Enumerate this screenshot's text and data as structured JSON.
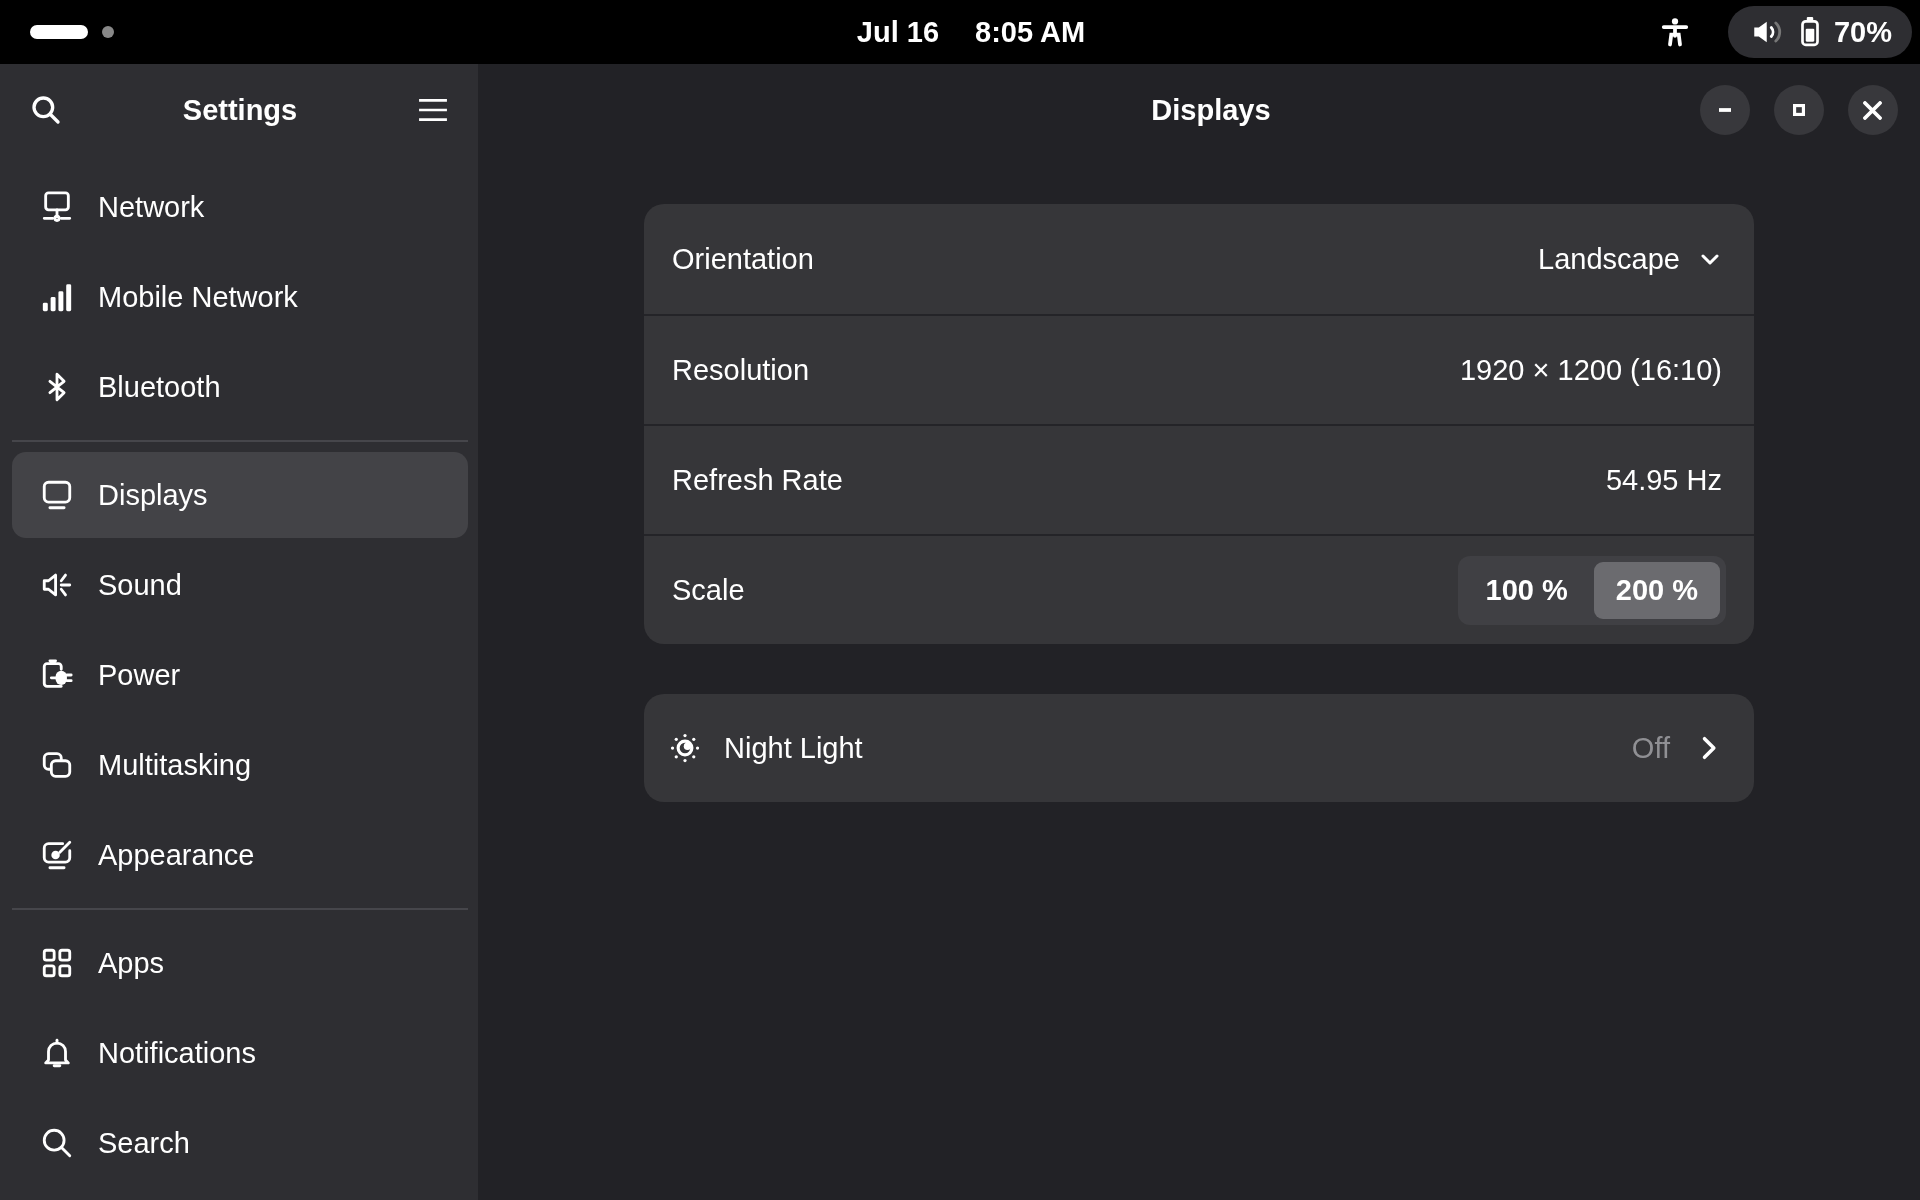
{
  "top_bar": {
    "date": "Jul 16",
    "time": "8:05 AM",
    "battery": "70%"
  },
  "sidebar": {
    "title": "Settings",
    "sections": [
      [
        {
          "label": "Network",
          "selected": false
        },
        {
          "label": "Mobile Network",
          "selected": false
        },
        {
          "label": "Bluetooth",
          "selected": false
        }
      ],
      [
        {
          "label": "Displays",
          "selected": true
        },
        {
          "label": "Sound",
          "selected": false
        },
        {
          "label": "Power",
          "selected": false
        },
        {
          "label": "Multitasking",
          "selected": false
        },
        {
          "label": "Appearance",
          "selected": false
        }
      ],
      [
        {
          "label": "Apps",
          "selected": false
        },
        {
          "label": "Notifications",
          "selected": false
        },
        {
          "label": "Search",
          "selected": false
        }
      ]
    ]
  },
  "window": {
    "title": "Displays"
  },
  "display_settings": [
    {
      "kind": "dropdown",
      "label": "Orientation",
      "value": "Landscape"
    },
    {
      "kind": "text",
      "label": "Resolution",
      "value": "1920 × 1200 (16:10)"
    },
    {
      "kind": "text",
      "label": "Refresh Rate",
      "value": "54.95 Hz"
    },
    {
      "kind": "toggle_group",
      "label": "Scale",
      "options": [
        {
          "label": "100 %",
          "selected": false
        },
        {
          "label": "200 %",
          "selected": true
        }
      ]
    }
  ],
  "night_light": {
    "label": "Night Light",
    "value": "Off"
  }
}
